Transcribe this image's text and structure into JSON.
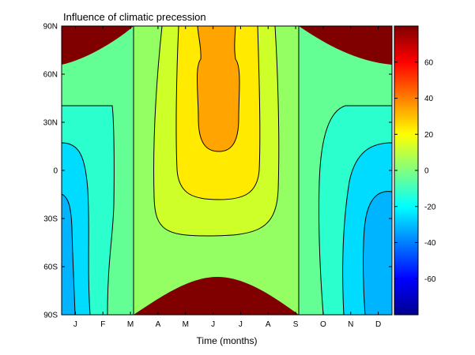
{
  "chart_data": {
    "type": "contour",
    "title": "Influence of climatic precession",
    "xlabel": "Time (months)",
    "ylabel": "",
    "x_ticks": [
      "J",
      "F",
      "M",
      "A",
      "M",
      "J",
      "J",
      "A",
      "S",
      "O",
      "N",
      "D"
    ],
    "y_ticks": [
      "90S",
      "60S",
      "30S",
      "0",
      "30N",
      "60N",
      "90N"
    ],
    "y_tick_values": [
      -90,
      -60,
      -30,
      0,
      30,
      60,
      90
    ],
    "ylim": [
      -90,
      90
    ],
    "colorbar": {
      "range": [
        -80,
        80
      ],
      "ticks": [
        -60,
        -40,
        -20,
        0,
        20,
        40,
        60
      ],
      "colormap": "jet"
    },
    "contour_levels": [
      -80,
      -40,
      -30,
      -20,
      -10,
      0,
      10,
      20,
      30,
      40,
      80
    ],
    "vertical_lines_months": [
      "M",
      "S"
    ]
  },
  "colors": {
    "dark_red": "#800000",
    "orange": "#ffa400",
    "yellow": "#ffea00",
    "yellow_green": "#ceff29",
    "light_green": "#94ff63",
    "aqua_green": "#63ff94",
    "cyan": "#2bffcd",
    "sky_blue": "#00dcff",
    "light_blue": "#00b4ff",
    "mid_blue": "#0094ff"
  }
}
